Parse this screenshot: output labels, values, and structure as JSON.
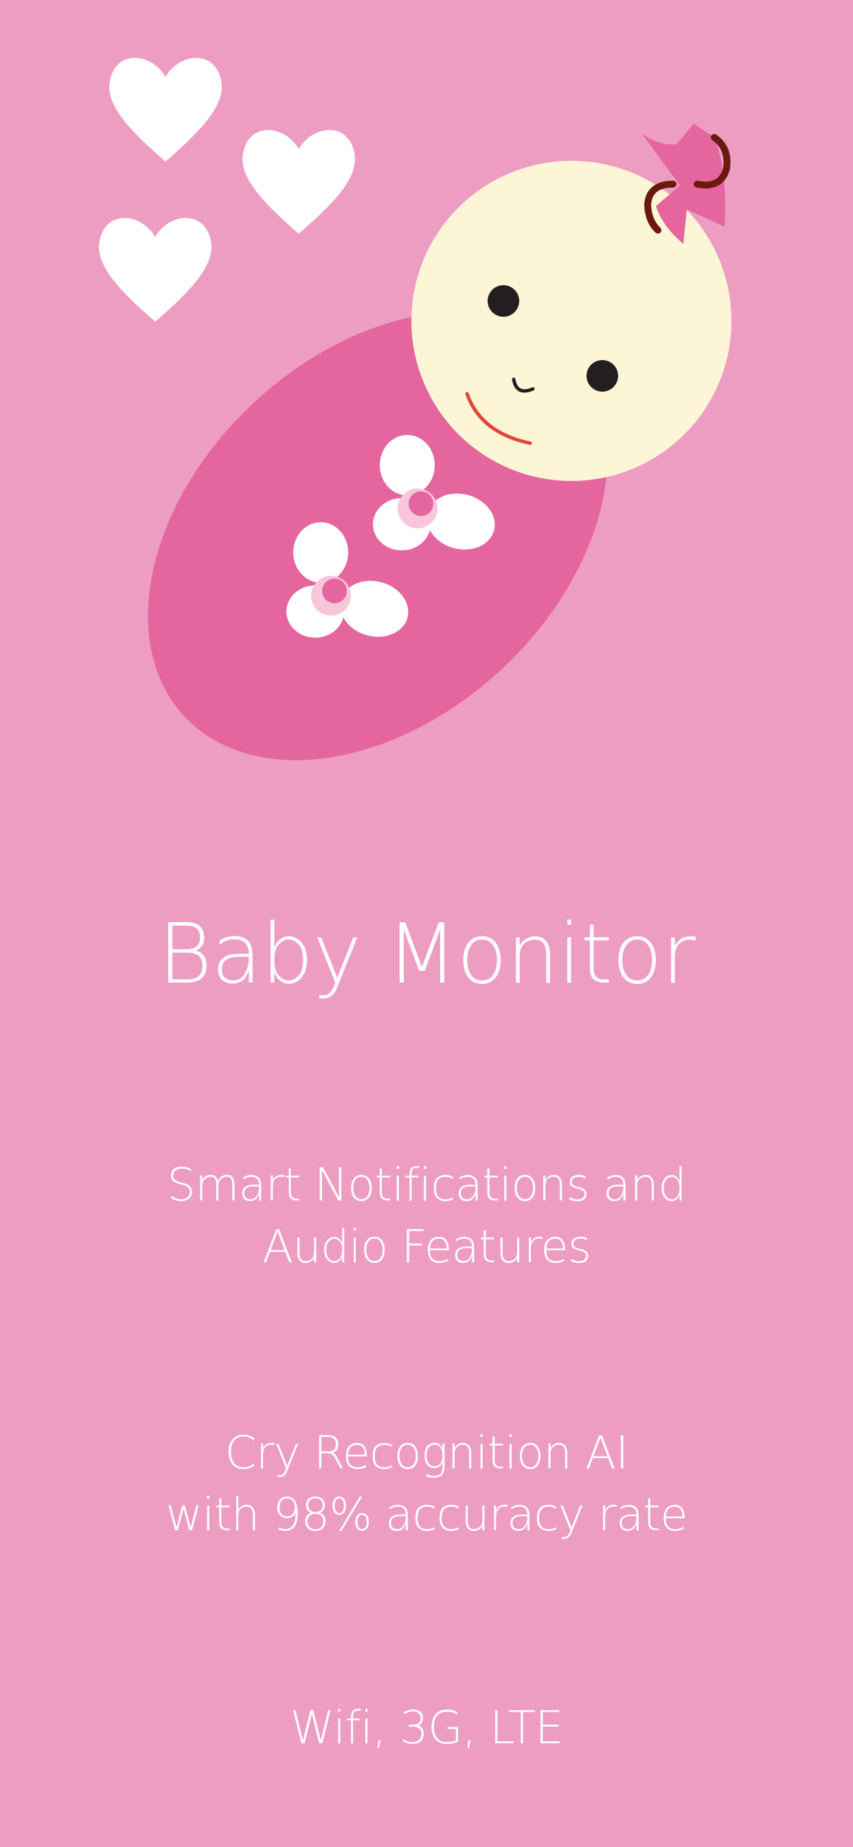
{
  "title": "Baby Monitor",
  "features": [
    {
      "line1": "Smart Notifications and",
      "line2": "Audio Features"
    },
    {
      "line1": "Cry Recognition AI",
      "line2": "with 98% accuracy rate"
    },
    {
      "line1": "Wifi, 3G, LTE"
    }
  ],
  "colors": {
    "background": "#ee9dc2",
    "blanket": "#e5669e",
    "face": "#fdf6d6",
    "text": "#ffffff"
  },
  "illustration": {
    "icons": [
      "heart-icon",
      "heart-icon",
      "heart-icon",
      "baby-icon",
      "bow-icon",
      "flower-icon"
    ]
  }
}
